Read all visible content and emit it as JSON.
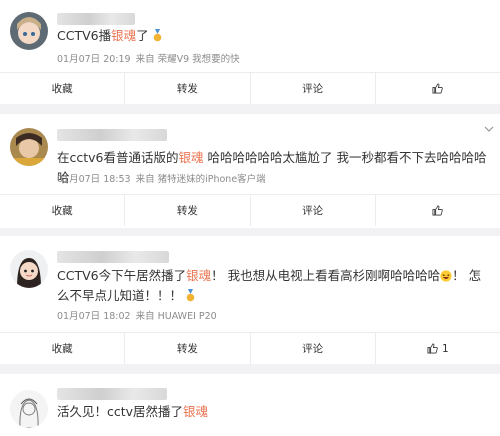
{
  "posts": [
    {
      "content_parts": [
        "CCTV6播",
        "银魂",
        "了"
      ],
      "date": "01月07日 20:19",
      "source": "来自 荣耀V9 我想要的快",
      "actions": {
        "collect": "收藏",
        "repost": "转发",
        "comment": "评论",
        "like_count": ""
      }
    },
    {
      "content_parts": [
        "在cctv6看普通话版的",
        "银魂",
        " 哈哈哈哈哈哈太尴尬了 我一秒都看不下去哈哈哈哈哈"
      ],
      "date": "01月07日 18:53",
      "source": "来自 猪特迷妹的iPhone客户端",
      "actions": {
        "collect": "收藏",
        "repost": "转发",
        "comment": "评论",
        "like_count": ""
      }
    },
    {
      "content_parts": [
        "CCTV6今下午居然播了",
        "银魂",
        "！ 我也想从电视上看看高杉刚啊哈哈哈哈",
        "！ 怎么不早点儿知道！！！"
      ],
      "date": "01月07日 18:02",
      "source": "来自 HUAWEI P20",
      "actions": {
        "collect": "收藏",
        "repost": "转发",
        "comment": "评论",
        "like_count": "1"
      }
    },
    {
      "content_parts": [
        "活久见！cctv居然播了",
        "银魂"
      ],
      "date": "",
      "source": "",
      "actions": {}
    }
  ],
  "icons": {
    "like": "thumbs-up-icon",
    "more": "chevron-down-icon",
    "laugh": "laughing-emoji-icon",
    "medal": "medal-icon"
  },
  "colors": {
    "keyword": "#eb7350",
    "meta": "#8c8c8c",
    "background": "#f2f2f5",
    "card": "#ffffff"
  }
}
